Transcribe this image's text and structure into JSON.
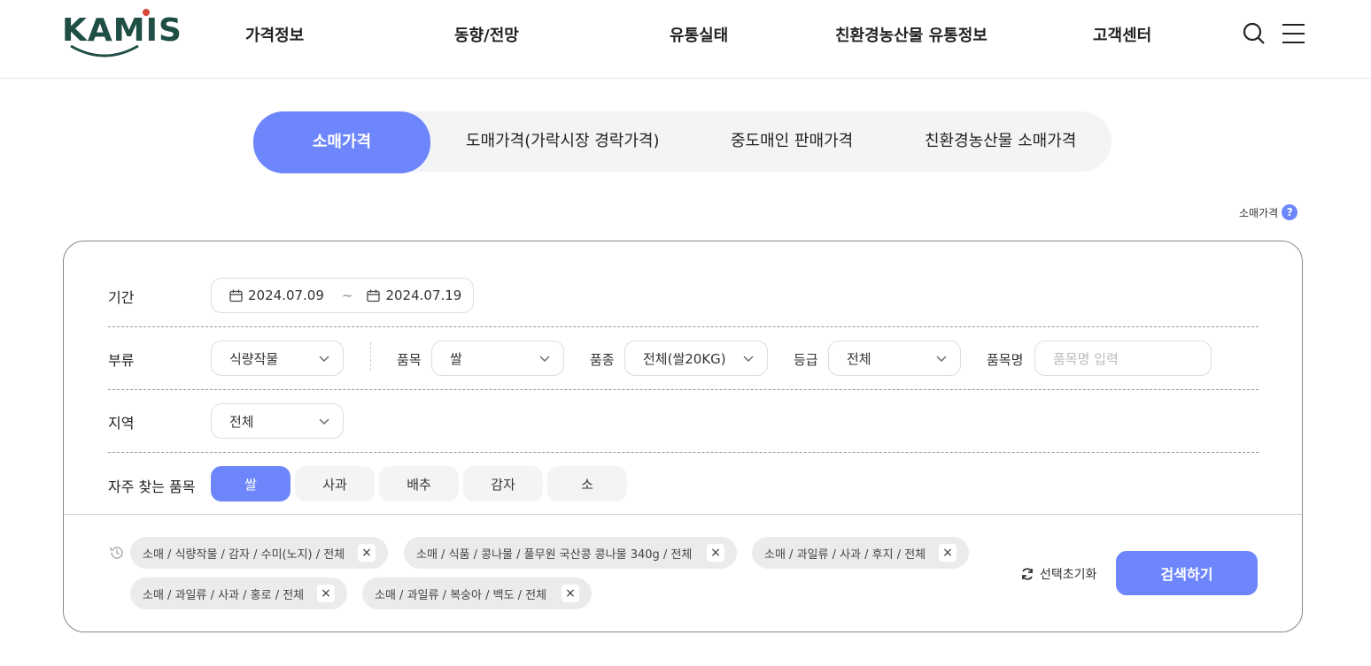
{
  "header": {
    "logo": "KAMIS",
    "nav": [
      "가격정보",
      "동향/전망",
      "유통실태",
      "친환경농산물 유통정보",
      "고객센터"
    ]
  },
  "tabs": [
    "소매가격",
    "도매가격(가락시장 경락가격)",
    "중도매인 판매가격",
    "친환경농산물 소매가격"
  ],
  "help_label": "소매가격",
  "help_badge": "?",
  "search": {
    "period_label": "기간",
    "date_from": "2024.07.09",
    "date_sep": "~",
    "date_to": "2024.07.19",
    "category_label": "부류",
    "category_value": "식량작물",
    "item_label": "품목",
    "item_value": "쌀",
    "variety_label": "품종",
    "variety_value": "전체(쌀20KG)",
    "grade_label": "등급",
    "grade_value": "전체",
    "name_label": "품목명",
    "name_placeholder": "품목명 입력",
    "region_label": "지역",
    "region_value": "전체",
    "frequent_label": "자주 찾는 품목",
    "frequent_items": [
      "쌀",
      "사과",
      "배추",
      "감자",
      "소"
    ]
  },
  "history": [
    "소매 / 식량작물 / 감자 / 수미(노지) / 전체",
    "소매 / 식품 / 콩나물 / 풀무원 국산콩 콩나물 340g / 전체",
    "소매 / 과일류 / 사과 / 후지 / 전체",
    "소매 / 과일류 / 사과 / 홍로 / 전체",
    "소매 / 과일류 / 복숭아 / 백도 / 전체"
  ],
  "tag_close": "×",
  "reset_label": "선택초기화",
  "search_button": "검색하기"
}
